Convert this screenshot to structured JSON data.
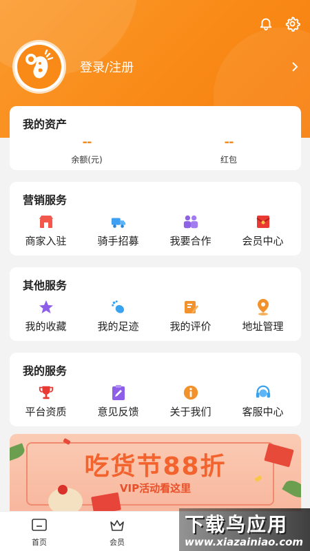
{
  "header": {
    "login_label": "登录/注册",
    "accent_color": "#f98a17",
    "icons": [
      "bell-icon",
      "gear-icon",
      "chevron-right-icon"
    ]
  },
  "assets": {
    "title": "我的资产",
    "items": [
      {
        "value": "--",
        "label": "余额(元)"
      },
      {
        "value": "--",
        "label": "红包"
      }
    ]
  },
  "marketing": {
    "title": "营销服务",
    "items": [
      {
        "label": "商家入驻",
        "icon": "shop-icon"
      },
      {
        "label": "骑手招募",
        "icon": "delivery-truck-icon"
      },
      {
        "label": "我要合作",
        "icon": "partners-icon"
      },
      {
        "label": "会员中心",
        "icon": "red-envelope-icon"
      }
    ]
  },
  "other": {
    "title": "其他服务",
    "items": [
      {
        "label": "我的收藏",
        "icon": "star-icon"
      },
      {
        "label": "我的足迹",
        "icon": "footprint-icon"
      },
      {
        "label": "我的评价",
        "icon": "edit-note-icon"
      },
      {
        "label": "地址管理",
        "icon": "location-pin-icon"
      }
    ]
  },
  "mine": {
    "title": "我的服务",
    "items": [
      {
        "label": "平台资质",
        "icon": "trophy-icon"
      },
      {
        "label": "意见反馈",
        "icon": "feedback-icon"
      },
      {
        "label": "关于我们",
        "icon": "info-icon"
      },
      {
        "label": "客服中心",
        "icon": "headset-icon"
      }
    ]
  },
  "banner": {
    "title": "吃货节88折",
    "subtitle": "VIP活动看这里"
  },
  "tabbar": {
    "items": [
      {
        "label": "首页",
        "icon": "home-icon"
      },
      {
        "label": "会员",
        "icon": "crown-icon"
      }
    ]
  },
  "watermark": {
    "line1": "下载鸟应用",
    "line2": "www.xiazainiao.com"
  }
}
